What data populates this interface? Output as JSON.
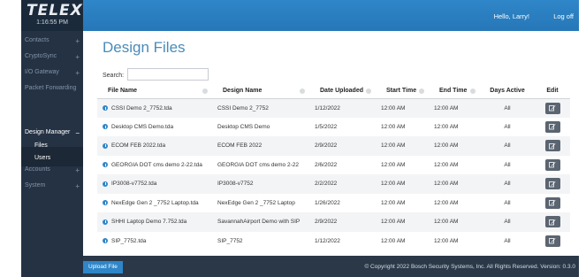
{
  "header": {
    "logo": "TELEX",
    "clock": "1:16:55 PM",
    "greeting": "Hello, Larry!",
    "logoff": "Log off"
  },
  "sidebar": {
    "items": [
      {
        "label": "Contacts",
        "expander": "+"
      },
      {
        "label": "CryptoSync",
        "expander": "+"
      },
      {
        "label": "I/O Gateway",
        "expander": "+"
      },
      {
        "label": "Packet Forwarding",
        "expander": ""
      },
      {
        "label": "Design Manager",
        "expander": "−"
      },
      {
        "label": "Accounts",
        "expander": "+"
      },
      {
        "label": "System",
        "expander": "+"
      }
    ],
    "subitems": [
      "Files",
      "Users"
    ]
  },
  "main": {
    "title": "Design Files",
    "search_label": "Search:",
    "search_value": ""
  },
  "table": {
    "columns": [
      "File Name",
      "Design Name",
      "Date Uploaded",
      "Start Time",
      "End Time",
      "Days Active",
      "Edit"
    ],
    "rows": [
      {
        "file": "CSSI Demo 2_7752.tda",
        "design": "CSSI Demo 2_7752",
        "date": "1/12/2022",
        "start": "12:00 AM",
        "end": "12:00 AM",
        "days": "All"
      },
      {
        "file": "Desktop CMS Demo.tda",
        "design": "Desktop CMS Demo",
        "date": "1/5/2022",
        "start": "12:00 AM",
        "end": "12:00 AM",
        "days": "All"
      },
      {
        "file": "ECOM FEB 2022.tda",
        "design": "ECOM FEB 2022",
        "date": "2/9/2022",
        "start": "12:00 AM",
        "end": "12:00 AM",
        "days": "All"
      },
      {
        "file": "GEORGIA DOT cms demo 2-22.tda",
        "design": "GEORGIA DOT cms demo 2-22",
        "date": "2/6/2022",
        "start": "12:00 AM",
        "end": "12:00 AM",
        "days": "All"
      },
      {
        "file": "IP3008-v7752.tda",
        "design": "IP3008-v7752",
        "date": "2/2/2022",
        "start": "12:00 AM",
        "end": "12:00 AM",
        "days": "All"
      },
      {
        "file": "NexEdge Gen 2 _7752 Laptop.tda",
        "design": "NexEdge Gen 2 _7752 Laptop",
        "date": "1/26/2022",
        "start": "12:00 AM",
        "end": "12:00 AM",
        "days": "All"
      },
      {
        "file": "SHHI Laptop Demo 7.752.tda",
        "design": "SavannahAirport Demo with SIP",
        "date": "2/9/2022",
        "start": "12:00 AM",
        "end": "12:00 AM",
        "days": "All"
      },
      {
        "file": "SIP_7752.tda",
        "design": "SIP_7752",
        "date": "1/12/2022",
        "start": "12:00 AM",
        "end": "12:00 AM",
        "days": "All"
      }
    ]
  },
  "footer": {
    "upload_label": "Upload File",
    "copyright": "© Copyright 2022 Bosch Security Systems, Inc. All Rights Reserved. Version: 0.3.0"
  },
  "colors": {
    "accent": "#2f86c8",
    "sidebar": "#243244",
    "title": "#4a8bb8",
    "edit_button": "#5b6571"
  },
  "icons": {
    "file_info": "info-circle-icon",
    "edit": "edit-pencil-icon",
    "sort": "sort-icon"
  }
}
